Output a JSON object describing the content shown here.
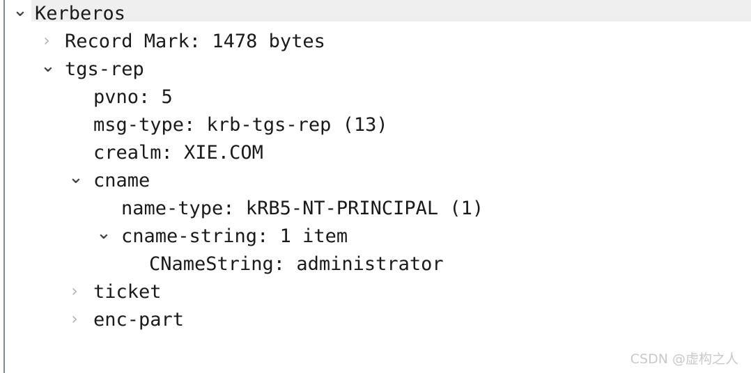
{
  "pane": {
    "name": "packet-details-tree",
    "accent_rule_color": "#7c8b96",
    "selection_color": "#efefef",
    "text_color": "#1a1a1a",
    "collapsed_chevron_color": "#b4b4b4",
    "expanded_chevron_color": "#404040"
  },
  "tree": {
    "rows": [
      {
        "label": "Kerberos",
        "level": 0,
        "state": "expanded",
        "selected": true,
        "icon": "chevron-down-icon"
      },
      {
        "label": "Record Mark: 1478 bytes",
        "level": 1,
        "state": "collapsed",
        "selected": false,
        "icon": "chevron-right-icon"
      },
      {
        "label": "tgs-rep",
        "level": 1,
        "state": "expanded",
        "selected": false,
        "icon": "chevron-down-icon"
      },
      {
        "label": "pvno: 5",
        "level": 2,
        "state": "leaf",
        "selected": false,
        "icon": "none"
      },
      {
        "label": "msg-type: krb-tgs-rep (13)",
        "level": 2,
        "state": "leaf",
        "selected": false,
        "icon": "none"
      },
      {
        "label": "crealm: XIE.COM",
        "level": 2,
        "state": "leaf",
        "selected": false,
        "icon": "none"
      },
      {
        "label": "cname",
        "level": 2,
        "state": "expanded",
        "selected": false,
        "icon": "chevron-down-icon"
      },
      {
        "label": "name-type: kRB5-NT-PRINCIPAL (1)",
        "level": 3,
        "state": "leaf",
        "selected": false,
        "icon": "none"
      },
      {
        "label": "cname-string: 1 item",
        "level": 3,
        "state": "expanded",
        "selected": false,
        "icon": "chevron-down-icon"
      },
      {
        "label": "CNameString: administrator",
        "level": 4,
        "state": "leaf",
        "selected": false,
        "icon": "none"
      },
      {
        "label": "ticket",
        "level": 2,
        "state": "collapsed",
        "selected": false,
        "icon": "chevron-right-icon"
      },
      {
        "label": "enc-part",
        "level": 2,
        "state": "collapsed",
        "selected": false,
        "icon": "chevron-right-icon"
      }
    ]
  },
  "watermark": {
    "text": "CSDN @虚构之人"
  }
}
